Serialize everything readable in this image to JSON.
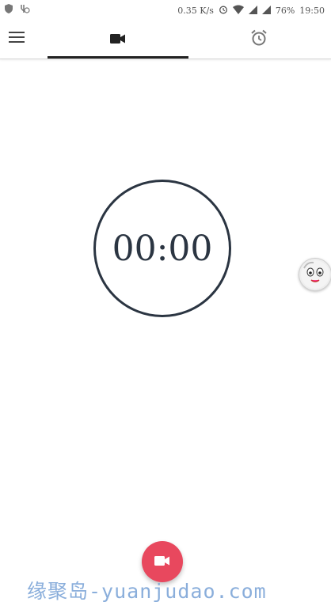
{
  "status_bar": {
    "net_speed": "0.35 K/s",
    "battery": "76%",
    "time": "19:50",
    "icons": [
      "shield-icon",
      "usb-debug-icon",
      "alarm-icon",
      "wifi-icon",
      "signal-icon",
      "signal-icon"
    ]
  },
  "app_bar": {
    "menu_icon": "hamburger-menu-icon",
    "tabs": [
      {
        "icon": "videocam-icon",
        "selected": true
      },
      {
        "icon": "alarm-clock-icon",
        "selected": false
      }
    ]
  },
  "timer": {
    "display": "00:00"
  },
  "fab": {
    "icon": "videocam-icon",
    "color": "#e8485e"
  },
  "watermark": {
    "text": "缘聚岛-yuanjudao.com"
  },
  "colors": {
    "timer": "#2b3542",
    "fab": "#e8485e",
    "watermark": "#7ea6d8"
  }
}
